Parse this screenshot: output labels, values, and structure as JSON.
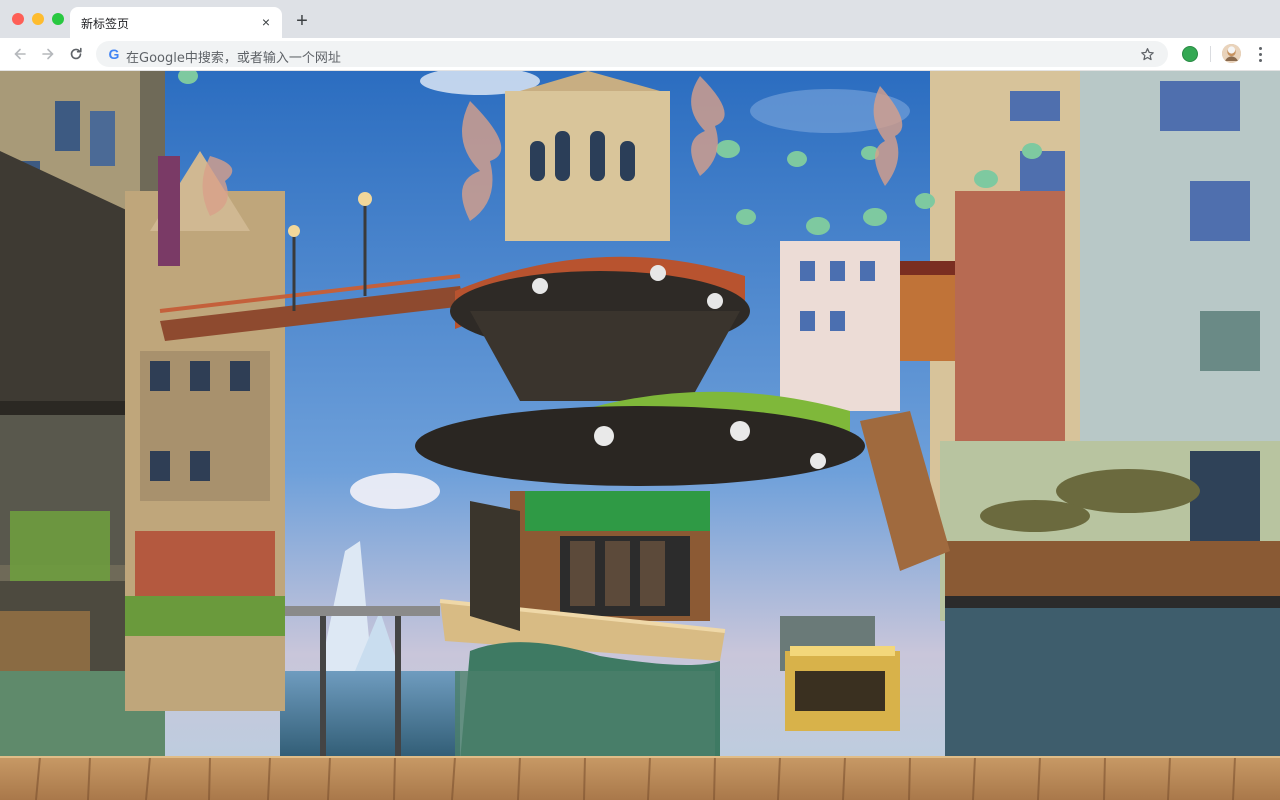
{
  "tab": {
    "title": "新标签页",
    "close": "×"
  },
  "newtab": "+",
  "omnibox": {
    "placeholder": "在Google中搜索，或者输入一个网址",
    "engine_icon": "G"
  },
  "colors": {
    "tabstrip": "#dee1e6",
    "sky": "#3c7ac2",
    "deck": "#b98a5a"
  }
}
